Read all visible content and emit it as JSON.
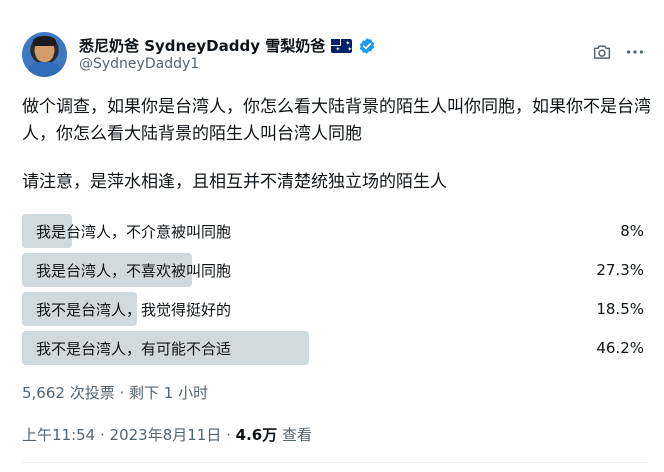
{
  "tweet": {
    "author": {
      "display_name": "悉尼奶爸 SydneyDaddy 雪梨奶爸",
      "handle": "@SydneyDaddy1",
      "flag_icon": "australia-flag-icon",
      "verified_icon": "verified-badge-icon",
      "verified_color": "#1d9bf0"
    },
    "text": {
      "paragraph1": "做个调查，如果你是台湾人，你怎么看大陆背景的陌生人叫你同胞，如果你不是台湾人，你怎么看大陆背景的陌生人叫台湾人同胞",
      "paragraph2": "请注意，是萍水相逢，且相互并不清楚统独立场的陌生人"
    },
    "poll": {
      "options": [
        {
          "label": "我是台湾人，不介意被叫同胞",
          "percent_text": "8%",
          "percent": 8
        },
        {
          "label": "我是台湾人，不喜欢被叫同胞",
          "percent_text": "27.3%",
          "percent": 27.3
        },
        {
          "label": "我不是台湾人，我觉得挺好的",
          "percent_text": "18.5%",
          "percent": 18.5
        },
        {
          "label": "我不是台湾人，有可能不合适",
          "percent_text": "46.2%",
          "percent": 46.2
        }
      ],
      "meta": "5,662 次投票 · 剩下 1 小时",
      "bar_color": "#cfd9de"
    },
    "timestamp": {
      "time_date": "上午11:54 · 2023年8月11日 · ",
      "views_count": "4.6万",
      "views_label": " 查看"
    }
  },
  "icons": {
    "camera": "camera-icon",
    "more": "more-options-icon"
  },
  "colors": {
    "text_primary": "#0f1419",
    "text_secondary": "#536471"
  }
}
